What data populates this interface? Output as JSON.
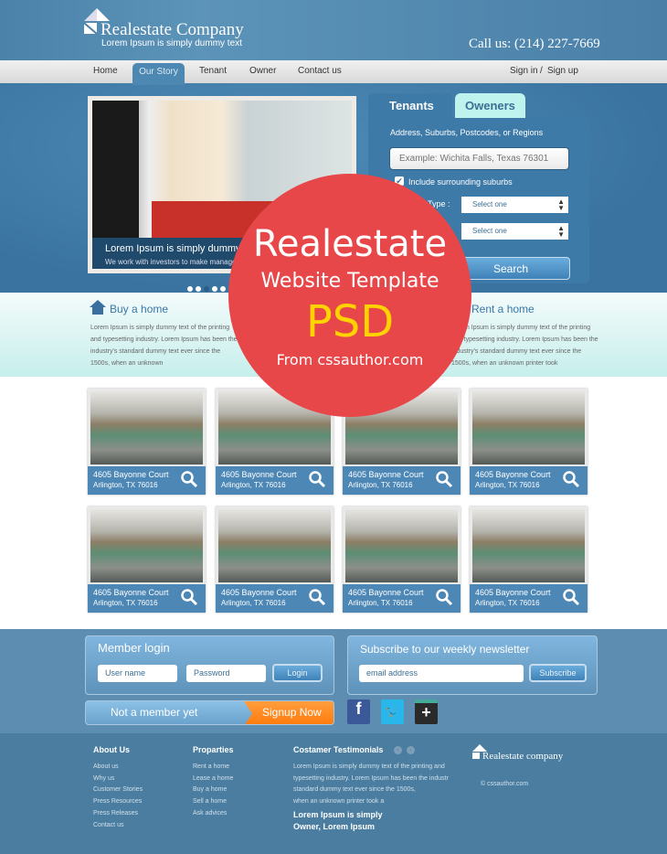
{
  "header": {
    "brand": "Realestate Company",
    "tagline": "Lorem Ipsum is simply dummy text",
    "phone": "Call us: (214) 227-7669"
  },
  "nav": {
    "items": [
      "Home",
      "Our Story",
      "Tenant",
      "Owner",
      "Contact us"
    ],
    "active": "Our Story",
    "sign_in": "Sign in",
    "sep": "/",
    "sign_up": "Sign up"
  },
  "slider": {
    "title": "Lorem Ipsum is simply dummy text",
    "subtitle": "We work with investors to make management easy",
    "active_dot": 3
  },
  "search": {
    "tabs": [
      "Tenants",
      "Oweners"
    ],
    "label": "Address, Suburbs, Postcodes, or Regions",
    "placeholder": "Example: Wichita Falls, Texas 76301",
    "checkbox_label": "Include surrounding suburbs",
    "checked": true,
    "type_label": "Type :",
    "select1": "Select one",
    "select2": "Select one",
    "button": "Search"
  },
  "features": [
    {
      "title": "Buy a home",
      "text": "Lorem Ipsum is simply dummy text of the printing and typesetting industry. Lorem Ipsum has been the industry's standard dummy text ever since the 1500s, when an unknown"
    },
    {
      "title": "Rent a home",
      "text": "Lorem Ipsum is simply dummy text of the printing and typesetting industry. Lorem Ipsum has been the industry's standard dummy text ever since the 1500s, when an unknown printer took"
    }
  ],
  "listings": [
    {
      "street": "4605 Bayonne Court",
      "city": "Arlington, TX 76016"
    },
    {
      "street": "4605 Bayonne Court",
      "city": "Arlington, TX 76016"
    },
    {
      "street": "4605 Bayonne Court",
      "city": "Arlington, TX 76016"
    },
    {
      "street": "4605 Bayonne Court",
      "city": "Arlington, TX 76016"
    },
    {
      "street": "4605 Bayonne Court",
      "city": "Arlington, TX 76016"
    },
    {
      "street": "4605 Bayonne Court",
      "city": "Arlington, TX 76016"
    },
    {
      "street": "4605 Bayonne Court",
      "city": "Arlington, TX 76016"
    },
    {
      "street": "4605 Bayonne Court",
      "city": "Arlington, TX 76016"
    }
  ],
  "login": {
    "title": "Member login",
    "username_placeholder": "User name",
    "password_placeholder": "Password",
    "button": "Login"
  },
  "newsletter": {
    "title": "Subscribe to our weekly newsletter",
    "email_placeholder": "email address",
    "button": "Subscribe"
  },
  "signup": {
    "text": "Not a member yet",
    "button": "Signup Now"
  },
  "social": [
    {
      "icon": "facebook-icon",
      "glyph": "f",
      "color": "#3b5998"
    },
    {
      "icon": "twitter-icon",
      "glyph": "t",
      "color": "#29b6ea"
    },
    {
      "icon": "google-plus-icon",
      "glyph": "+",
      "color": "#2a2a2a"
    }
  ],
  "footer": {
    "about": {
      "title": "About Us",
      "links": [
        "About us",
        "Why us",
        "Customer Stories",
        "Press Resources",
        "Press Releases",
        "Contact us"
      ]
    },
    "properties": {
      "title": "Proparties",
      "links": [
        "Rent a home",
        "Lease a home",
        "Buy a home",
        "Sell a home",
        "Ask advices"
      ]
    },
    "testimonials": {
      "title": "Costamer Testimonials",
      "lines": [
        "Lorem Ipsum is simply dummy text of the printing and",
        "typesetting industry. Lorem Ipsum has been the industr",
        "standard dummy text ever since the 1500s,",
        "when an unknown printer took a"
      ],
      "author": "Lorem Ipsum is simply",
      "role": "Owner, Lorem Ipsum"
    },
    "brand": "Realestate company",
    "copyright": "© cssauthor.com"
  },
  "badge": {
    "line1": "Realestate",
    "line2": "Website Template",
    "line3": "PSD",
    "line4": "From cssauthor.com"
  },
  "colors": {
    "primary": "#4a82aa",
    "accent": "#ff7a0a",
    "badge": "#e8474a",
    "badge_text": "#ffd200"
  }
}
